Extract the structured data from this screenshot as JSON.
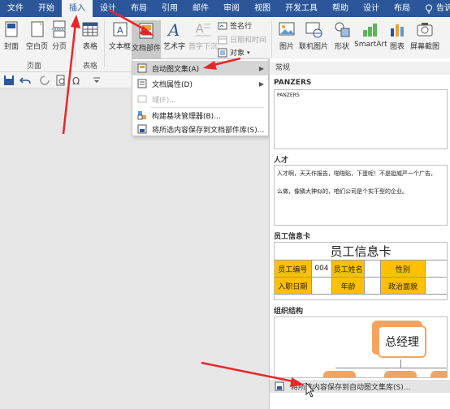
{
  "tabs": [
    {
      "label": "文件"
    },
    {
      "label": "开始"
    },
    {
      "label": "插入",
      "active": true
    },
    {
      "label": "设计"
    },
    {
      "label": "布局"
    },
    {
      "label": "引用"
    },
    {
      "label": "邮件"
    },
    {
      "label": "审阅"
    },
    {
      "label": "视图"
    },
    {
      "label": "开发工具"
    },
    {
      "label": "帮助"
    },
    {
      "label": "设计"
    },
    {
      "label": "布局"
    }
  ],
  "help_tab": "告诉我",
  "ribbon": {
    "cover": "封面",
    "blank_page": "空白页",
    "page_break": "分页",
    "pages_group": "页面",
    "table": "表格",
    "table_group": "表格",
    "textbox": "文本框",
    "doc_parts": "文档部件",
    "wordart": "艺术字",
    "dropcap": "首字下沉",
    "signature_line": "签名行",
    "date_time": "日期和时间",
    "object": "对象",
    "picture": "图片",
    "online_picture": "联机图片",
    "shapes": "形状",
    "smartart": "SmartArt",
    "chart": "图表",
    "screenshot": "屏幕截图"
  },
  "menu": {
    "autotext": "自动图文集(A)",
    "doc_property": "文档属性(D)",
    "field": "域(F)...",
    "building_blocks": "构建基块管理器(B)...",
    "save_to_gallery": "将所选内容保存到文档部件库(S)..."
  },
  "gallery": {
    "header": "常规",
    "entries": [
      {
        "label": "PANZERS",
        "preview": "PANZERS"
      },
      {
        "label": "人才",
        "line1": "人才啊，天天作报告，啪啪贴，下蛋呢！不是挺威严一个广告，",
        "line2": "么做，像鳞大神似的，咱们公司是个实干型的企业。"
      },
      {
        "label": "员工信息卡"
      },
      {
        "label": "组织结构"
      }
    ],
    "emp_card": {
      "title": "员工信息卡",
      "row1": [
        "员工编号",
        "004",
        "员工姓名",
        "",
        "性别",
        ""
      ],
      "row2": [
        "入职日期",
        "",
        "年龄",
        "",
        "政治面貌",
        ""
      ]
    },
    "org": {
      "top": "总经理"
    },
    "footer": "将所选内容保存到自动图文集库(S)..."
  }
}
